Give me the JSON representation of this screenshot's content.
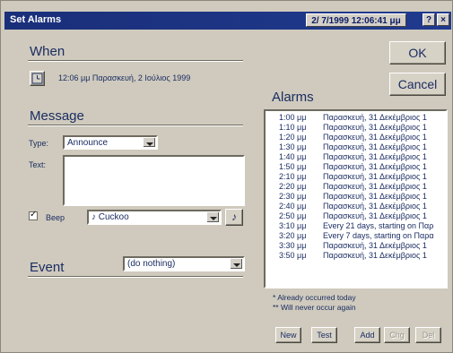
{
  "window": {
    "title": "Set Alarms"
  },
  "titlebar": {
    "date": "2/ 7/1999",
    "time": "12:06:41 μμ",
    "help": "?",
    "close": "×"
  },
  "when": {
    "heading": "When",
    "datetime": "12:06 μμ  Παρασκευή, 2 Ιούλιος 1999"
  },
  "buttons": {
    "ok": "OK",
    "cancel": "Cancel",
    "new": "New",
    "test": "Test",
    "add": "Add",
    "chg": "Chg",
    "del": "Del"
  },
  "message": {
    "heading": "Message",
    "type_label": "Type:",
    "type_value": "Announce",
    "text_label": "Text:",
    "text_value": "",
    "beep_label": "Beep",
    "beep_checked": true,
    "sound_value": "♪ Cuckoo",
    "play_icon": "♪"
  },
  "event": {
    "heading": "Event",
    "value": "(do nothing)"
  },
  "alarms": {
    "heading": "Alarms",
    "items": [
      {
        "time": "1:00 μμ",
        "desc": "Παρασκευή, 31 Δεκέμβριος 1"
      },
      {
        "time": "1:10 μμ",
        "desc": "Παρασκευή, 31 Δεκέμβριος 1"
      },
      {
        "time": "1:20 μμ",
        "desc": "Παρασκευή, 31 Δεκέμβριος 1"
      },
      {
        "time": "1:30 μμ",
        "desc": "Παρασκευή, 31 Δεκέμβριος 1"
      },
      {
        "time": "1:40 μμ",
        "desc": "Παρασκευή, 31 Δεκέμβριος 1"
      },
      {
        "time": "1:50 μμ",
        "desc": "Παρασκευή, 31 Δεκέμβριος 1"
      },
      {
        "time": "2:10 μμ",
        "desc": "Παρασκευή, 31 Δεκέμβριος 1"
      },
      {
        "time": "2:20 μμ",
        "desc": "Παρασκευή, 31 Δεκέμβριος 1"
      },
      {
        "time": "2:30 μμ",
        "desc": "Παρασκευή, 31 Δεκέμβριος 1"
      },
      {
        "time": "2:40 μμ",
        "desc": "Παρασκευή, 31 Δεκέμβριος 1"
      },
      {
        "time": "2:50 μμ",
        "desc": "Παρασκευή, 31 Δεκέμβριος 1"
      },
      {
        "time": "3:10 μμ",
        "desc": "Every 21 days, starting on Παρ"
      },
      {
        "time": "3:20 μμ",
        "desc": "Every 7 days, starting on Παρα"
      },
      {
        "time": "3:30 μμ",
        "desc": "Παρασκευή, 31 Δεκέμβριος 1"
      },
      {
        "time": "3:50 μμ",
        "desc": "Παρασκευή, 31 Δεκέμβριος 1"
      }
    ],
    "note1": "* Already occurred today",
    "note2": "** Will never occur again"
  }
}
